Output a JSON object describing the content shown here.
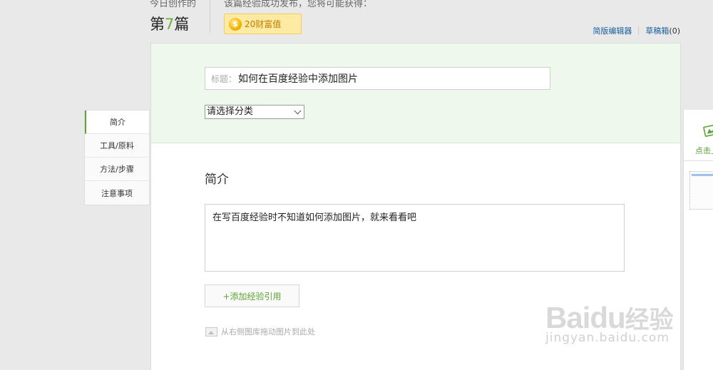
{
  "header": {
    "today_label": "今日创作的",
    "count_prefix": "第",
    "count_number": "7",
    "count_suffix": "篇",
    "publish_message": "该篇经验成功发布，您将可能获得：",
    "reward_coin_glyph": "$",
    "reward_text": "20财富值",
    "links": {
      "simple_editor": "简版编辑器",
      "drafts_label": "草稿箱",
      "drafts_count": "(0)"
    }
  },
  "sidebar": {
    "items": [
      {
        "label": "简介",
        "active": true
      },
      {
        "label": "工具/原料"
      },
      {
        "label": "方法/步骤"
      },
      {
        "label": "注意事项"
      }
    ]
  },
  "editor": {
    "title_label": "标题：",
    "title_value": "如何在百度经验中添加图片",
    "category_select": "请选择分类",
    "section_heading": "简介",
    "intro_text": "在写百度经验时不知道如何添加图片，就来看看吧",
    "add_reference_button": "+添加经验引用",
    "drag_hint": "从右侧图库拖动图片到此处"
  },
  "right_panel": {
    "upload_label": "点击上"
  },
  "watermark": {
    "logo_text": "Bai",
    "logo_paw": "du",
    "logo_cn": "经验",
    "url": "jingyan.baidu.com"
  },
  "colors": {
    "accent_green": "#5aa534",
    "link_blue": "#1a5e9f",
    "reward_bg": "#fdeba4",
    "panel_tint": "#eef8ec"
  }
}
